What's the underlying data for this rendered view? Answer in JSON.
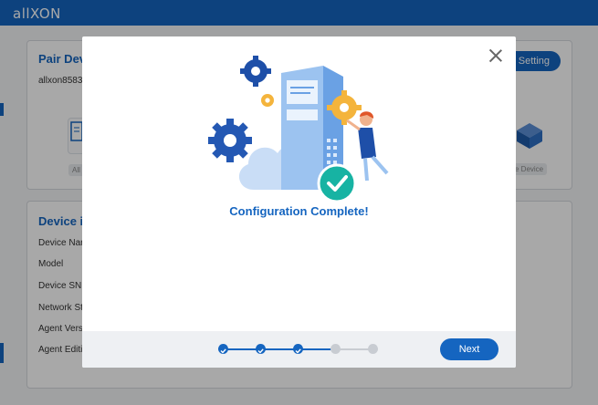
{
  "app": {
    "logo": "allXON",
    "pair_card": {
      "title": "Pair Devi",
      "device_id": "allxon8583",
      "setting_button": "t Setting",
      "tile_left_label": "All",
      "tile_right_label": "e Device"
    },
    "info_card": {
      "title": "Device in",
      "fields": [
        "Device Nar",
        "Model",
        "Device SN",
        "Network St",
        "Agent Vers",
        "Agent Editi"
      ]
    }
  },
  "modal": {
    "title": "Configuration Complete!",
    "next_button": "Next",
    "steps": {
      "total": 5,
      "completed": 3
    }
  },
  "colors": {
    "brand": "#1565c0",
    "success": "#17b3a3",
    "gear": "#f4b43c"
  }
}
